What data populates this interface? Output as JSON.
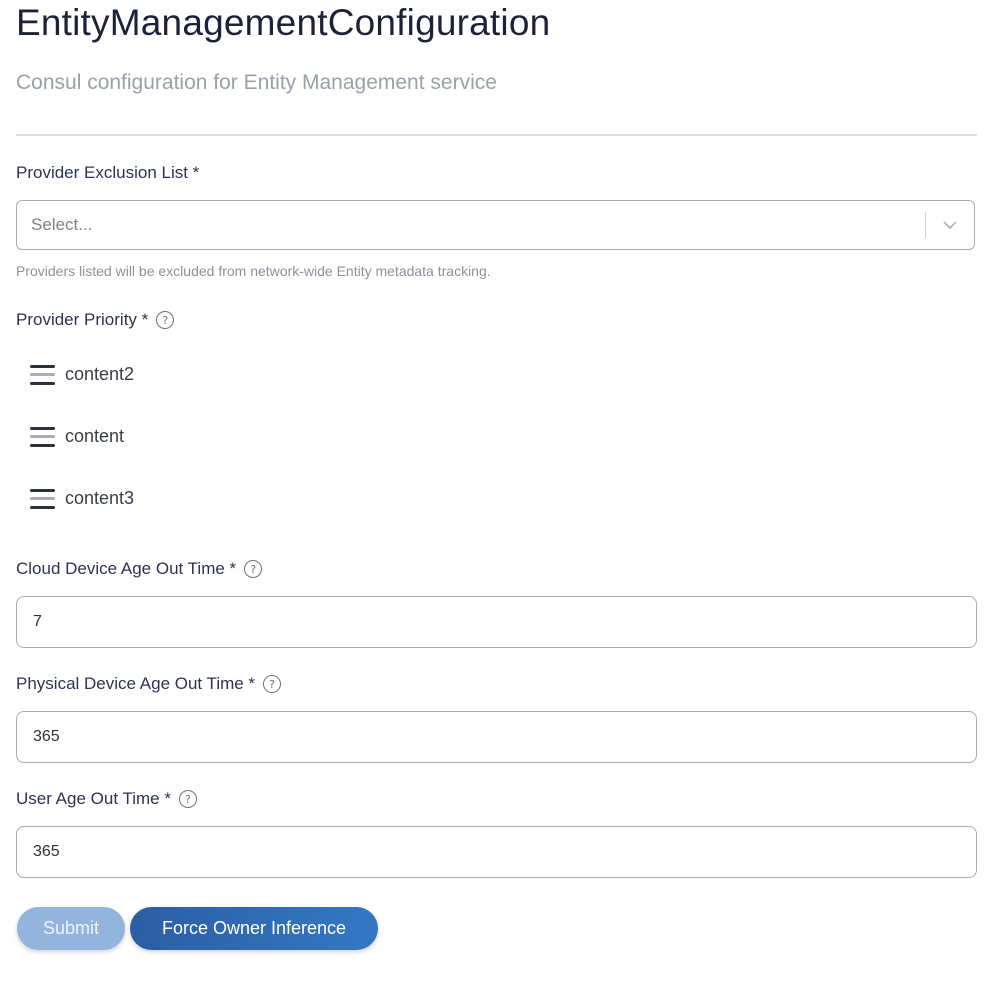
{
  "header": {
    "title": "EntityManagementConfiguration",
    "subtitle": "Consul configuration for Entity Management service"
  },
  "provider_exclusion": {
    "label": "Provider Exclusion List *",
    "placeholder": "Select...",
    "hint": "Providers listed will be excluded from network-wide Entity metadata tracking."
  },
  "provider_priority": {
    "label": "Provider Priority *",
    "help_icon": "?",
    "items": [
      "content2",
      "content",
      "content3"
    ]
  },
  "cloud_age": {
    "label": "Cloud Device Age Out Time *",
    "help_icon": "?",
    "value": "7"
  },
  "physical_age": {
    "label": "Physical Device Age Out Time *",
    "help_icon": "?",
    "value": "365"
  },
  "user_age": {
    "label": "User Age Out Time *",
    "help_icon": "?",
    "value": "365"
  },
  "actions": {
    "submit": "Submit",
    "force": "Force Owner Inference"
  },
  "colors": {
    "primary": "#2e69b3",
    "primary_disabled": "#93b4dc",
    "text": "#2f3256",
    "muted": "#9aa0aa"
  }
}
